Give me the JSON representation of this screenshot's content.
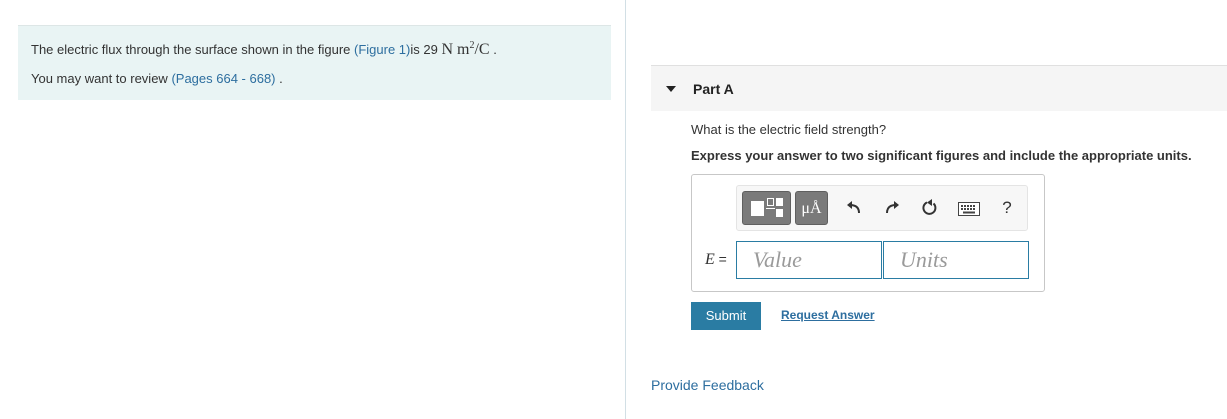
{
  "intro": {
    "flux_text_before": "The electric flux through the surface shown in the figure ",
    "figure_link": "(Figure 1)",
    "flux_text_mid": "is 29 ",
    "flux_unit_main": "N m",
    "flux_unit_exp": "2",
    "flux_unit_tail": "/C",
    "flux_text_end": " .",
    "review_text": "You may want to review ",
    "review_link": "(Pages 664 - 668)",
    "review_end": " ."
  },
  "part": {
    "title": "Part A"
  },
  "question": {
    "prompt": "What is the electric field strength?",
    "instruction": "Express your answer to two significant figures and include the appropriate units."
  },
  "toolbar": {
    "units_label": "μÅ",
    "help_label": "?",
    "icons": [
      "templates-icon",
      "units-icon",
      "undo-icon",
      "redo-icon",
      "reset-icon",
      "keyboard-icon",
      "help-icon"
    ]
  },
  "answer": {
    "var_name": "E",
    "equals": " =",
    "value_placeholder": "Value",
    "units_placeholder": "Units"
  },
  "actions": {
    "submit": "Submit",
    "request": "Request Answer",
    "feedback": "Provide Feedback"
  },
  "colors": {
    "accent": "#2a7ca3",
    "link": "#2d6e9f",
    "intro_bg": "#e9f4f4"
  }
}
